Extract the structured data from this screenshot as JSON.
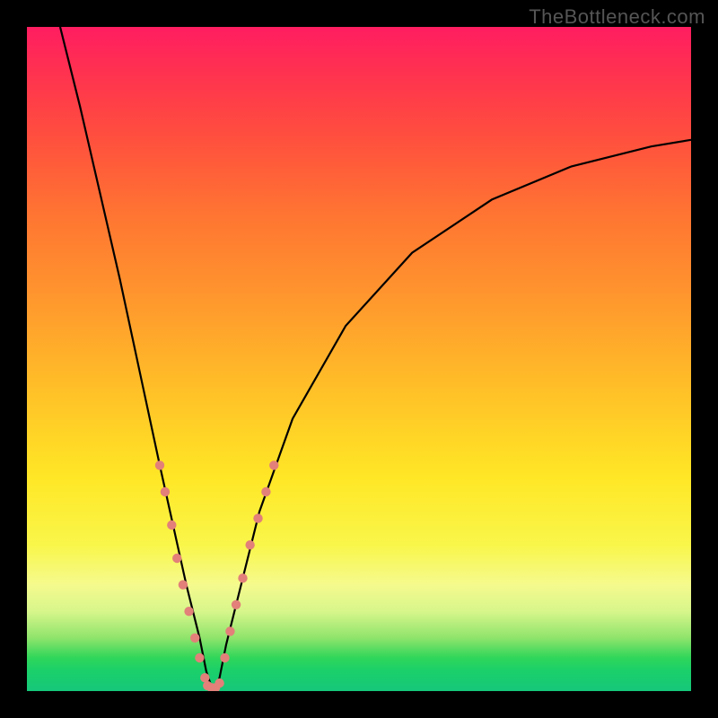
{
  "watermark": "TheBottleneck.com",
  "chart_data": {
    "type": "line",
    "title": "",
    "xlabel": "",
    "ylabel": "",
    "xlim": [
      0,
      100
    ],
    "ylim": [
      0,
      100
    ],
    "grid": false,
    "legend": false,
    "series": [
      {
        "name": "bottleneck-curve",
        "color": "#000000",
        "x": [
          5,
          8,
          11,
          14,
          17,
          20,
          22,
          24,
          26,
          27,
          28,
          29,
          30,
          32,
          35,
          40,
          48,
          58,
          70,
          82,
          94,
          100
        ],
        "y": [
          100,
          88,
          75,
          62,
          48,
          34,
          25,
          16,
          8,
          3,
          0,
          2,
          7,
          15,
          27,
          41,
          55,
          66,
          74,
          79,
          82,
          83
        ]
      },
      {
        "name": "dotted-markers-left",
        "color": "#e28079",
        "type": "scatter",
        "x": [
          20.0,
          20.8,
          21.8,
          22.6,
          23.5,
          24.4,
          25.3,
          26.0,
          26.8
        ],
        "y": [
          34,
          30,
          25,
          20,
          16,
          12,
          8,
          5,
          2
        ]
      },
      {
        "name": "dotted-markers-bottom",
        "color": "#e28079",
        "type": "scatter",
        "x": [
          27.2,
          27.8,
          28.4,
          29.0
        ],
        "y": [
          0.8,
          0.5,
          0.5,
          1.2
        ]
      },
      {
        "name": "dotted-markers-right",
        "color": "#e28079",
        "type": "scatter",
        "x": [
          29.8,
          30.6,
          31.5,
          32.5,
          33.6,
          34.8,
          36.0,
          37.2
        ],
        "y": [
          5,
          9,
          13,
          17,
          22,
          26,
          30,
          34
        ]
      }
    ],
    "gradient_stops": [
      {
        "pos": 0,
        "color": "#ff1d61"
      },
      {
        "pos": 16,
        "color": "#ff4d3f"
      },
      {
        "pos": 42,
        "color": "#ff9a2d"
      },
      {
        "pos": 68,
        "color": "#ffe726"
      },
      {
        "pos": 84,
        "color": "#f5fa8d"
      },
      {
        "pos": 95,
        "color": "#2fd65a"
      },
      {
        "pos": 100,
        "color": "#16c77a"
      }
    ]
  }
}
